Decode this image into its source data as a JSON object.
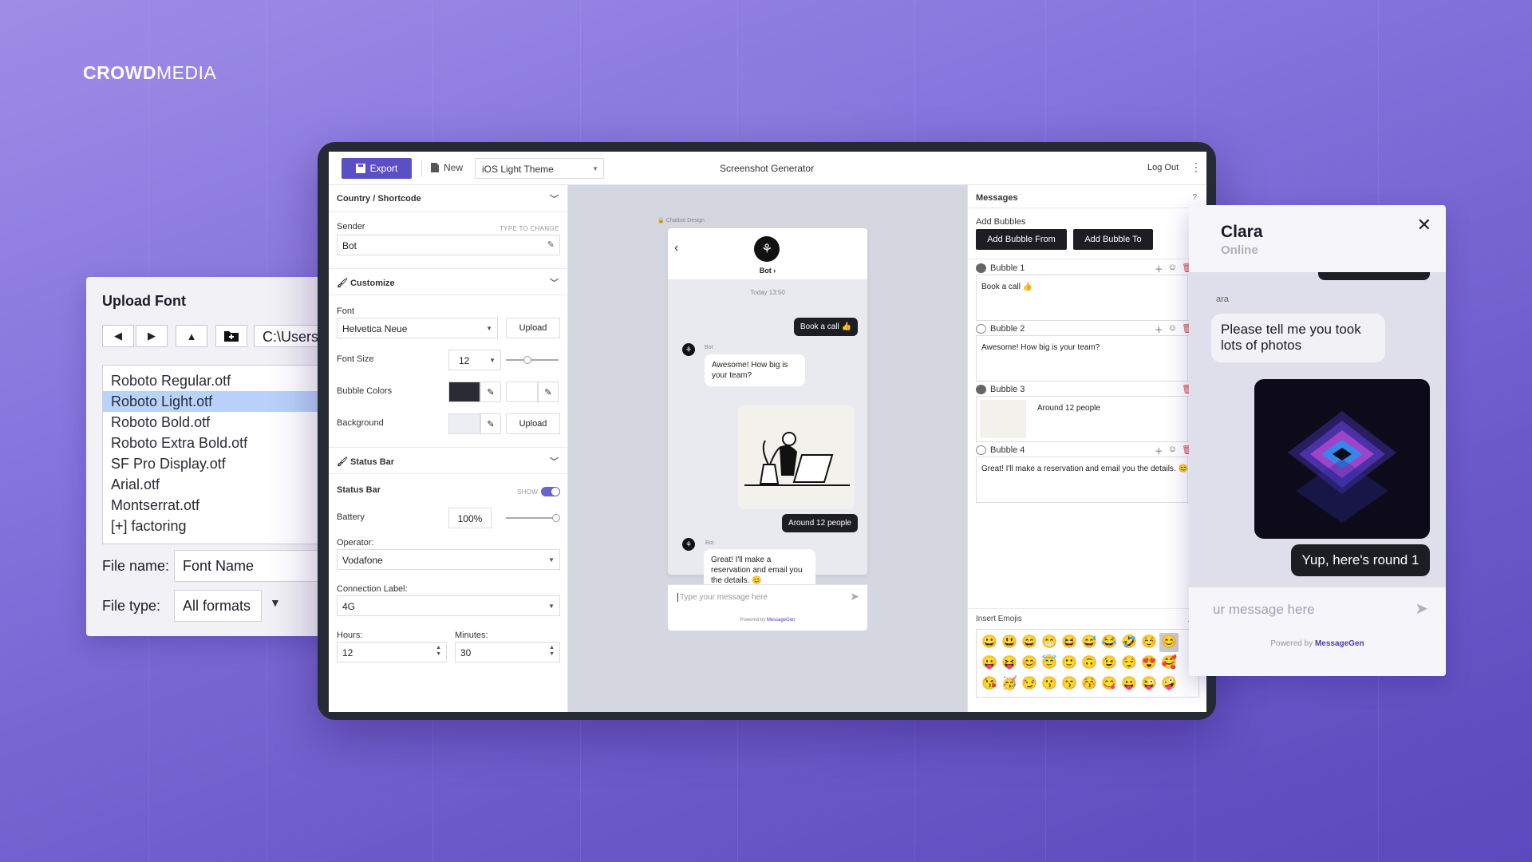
{
  "brand": {
    "logo_bold": "CROWD",
    "logo_light": "MEDIA"
  },
  "upload_font": {
    "title": "Upload Font",
    "path": "C:\\Users\\",
    "files": [
      "Roboto Regular.otf",
      "Roboto Light.otf",
      "Roboto Bold.otf",
      "Roboto Extra Bold.otf",
      "SF Pro Display.otf",
      "Arial.otf",
      "Montserrat.otf",
      "[+] factoring"
    ],
    "selected_index": 1,
    "file_name_label": "File name:",
    "file_name_value": "Font Name",
    "file_type_label": "File type:",
    "file_type_value": "All formats"
  },
  "toolbar": {
    "export_label": "Export",
    "new_label": "New",
    "theme_value": "iOS Light Theme",
    "title": "Screenshot Generator",
    "logout_label": "Log Out"
  },
  "left": {
    "country_section": "Country / Shortcode",
    "sender_label": "Sender",
    "sender_hint": "TYPE TO CHANGE",
    "sender_value": "Bot",
    "customize_section": "Customize",
    "font_label": "Font",
    "font_value": "Helvetica Neue",
    "upload_label": "Upload",
    "font_size_label": "Font Size",
    "font_size_value": "12",
    "bubble_colors_label": "Bubble Colors",
    "background_label": "Background",
    "status_bar_section": "Status Bar",
    "status_bar_label": "Status Bar",
    "show_label": "SHOW",
    "battery_label": "Battery",
    "battery_value": "100%",
    "operator_label": "Operator:",
    "operator_value": "Vodafone",
    "connection_label": "Connection Label:",
    "connection_value": "4G",
    "hours_label": "Hours:",
    "hours_value": "12",
    "minutes_label": "Minutes:",
    "minutes_value": "30"
  },
  "preview": {
    "caption": "Chatbot Design",
    "bot_name": "Bot",
    "date": "Today 13:50",
    "msg1": "Book a call 👍",
    "sender_small": "Bot",
    "msg2": "Awesome! How big is your team?",
    "msg3": "Around 12 people",
    "msg4": "Great! I'll make a reservation and email you the details. 😊",
    "input_placeholder": "Type your message here",
    "powered_prefix": "Powered by ",
    "powered_brand": "MessageGen"
  },
  "messages": {
    "title": "Messages",
    "help": "?",
    "add_bubbles_label": "Add Bubbles",
    "add_from": "Add Bubble From",
    "add_to": "Add Bubble To",
    "bubbles": [
      {
        "title": "Bubble 1",
        "text": "Book a call 👍"
      },
      {
        "title": "Bubble 2",
        "text": "Awesome! How big is your team?"
      },
      {
        "title": "Bubble 3",
        "text": "Around 12 people"
      },
      {
        "title": "Bubble 4",
        "text": "Great! I'll make a reservation and email you the details. 😊"
      }
    ],
    "insert_emojis": "Insert Emojis",
    "emojis": [
      "😀",
      "😃",
      "😄",
      "😁",
      "😆",
      "😅",
      "😂",
      "🤣",
      "☺️",
      "😊",
      "😛",
      "😝",
      "😊",
      "😇",
      "🙂",
      "🙃",
      "😉",
      "😌",
      "😍",
      "🥰",
      "😘",
      "🥳",
      "😏",
      "😗",
      "😙",
      "😚",
      "😋",
      "😛",
      "😜",
      "🤪",
      "🤨",
      "😔",
      "😣"
    ]
  },
  "clara": {
    "name": "Clara",
    "status": "Online",
    "sender_fragment": "ara",
    "msg_in": "Please tell me you took lots of photos",
    "msg_out": "Yup, here's round 1",
    "input_placeholder": "ur message here",
    "powered_prefix": "Powered by ",
    "powered_brand": "MessageGen"
  }
}
